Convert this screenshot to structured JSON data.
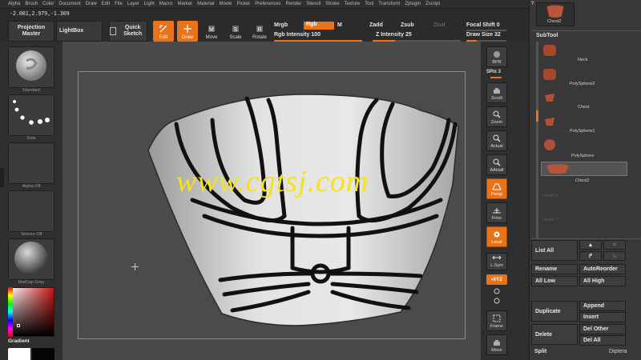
{
  "menu": [
    "Alpha",
    "Brush",
    "Color",
    "Document",
    "Draw",
    "Edit",
    "File",
    "Layer",
    "Light",
    "Macro",
    "Marker",
    "Material",
    "Movie",
    "Picker",
    "Preferences",
    "Render",
    "Stencil",
    "Stroke",
    "Texture",
    "Tool",
    "Transform",
    "Zplugin",
    "Zscript"
  ],
  "coords": "-2.081,2.979,-1.309",
  "toolbar": {
    "projection_master": "Projection Master",
    "lightbox": "LightBox",
    "quick_sketch": "Quick Sketch",
    "edit": "Edit",
    "draw": "Draw",
    "move": "Move",
    "scale": "Scale",
    "rotate": "Rotate",
    "mrgb": "Mrgb",
    "rgb": "Rgb",
    "m": "M",
    "zadd": "Zadd",
    "zsub": "Zsub",
    "zcut": "Zcut",
    "rgb_intensity": "Rgb Intensity 100",
    "z_intensity": "Z Intensity 25",
    "focal_shift": "Focal Shift 0",
    "draw_size": "Draw Size 32",
    "rgb_intensity_value": 1.0,
    "z_intensity_value": 0.25,
    "draw_size_value": 0.25
  },
  "left_shelf": {
    "brush": "Standard",
    "stroke": "Dots",
    "alpha": "Alpha  Off",
    "texture": "Texture  Off",
    "material": "MatCap Gray",
    "gradient": "Gradient"
  },
  "right_shelf": {
    "bpr": "BPR",
    "spix": "SPix 3",
    "scroll": "Scroll",
    "zoom": "Zoom",
    "actual": "Actual",
    "aahalf": "AAHalf",
    "persp": "Persp",
    "floor": "Floor",
    "local": "Local",
    "lsym": "L.Sym",
    "xyz": "•XYZ",
    "frame": "Frame",
    "move": "Move"
  },
  "watermark": "www.cgtsj.com",
  "subtool": {
    "top_label": "Chest2",
    "title": "SubTool",
    "items": [
      "Neck",
      "PolySphere2",
      "Chest",
      "PolySphere1",
      "PolySphere",
      "Chest2",
      "Undef 6",
      "Undef 7"
    ],
    "list_all": "List All",
    "rename": "Rename",
    "auto_reorder": "AutoReorder",
    "all_low": "All Low",
    "all_high": "All High",
    "duplicate": "Duplicate",
    "append": "Append",
    "insert": "Insert",
    "delete": "Delete",
    "del_other": "Del Other",
    "del_all": "Del All",
    "split": "Split",
    "corner_label": "Diptera"
  }
}
